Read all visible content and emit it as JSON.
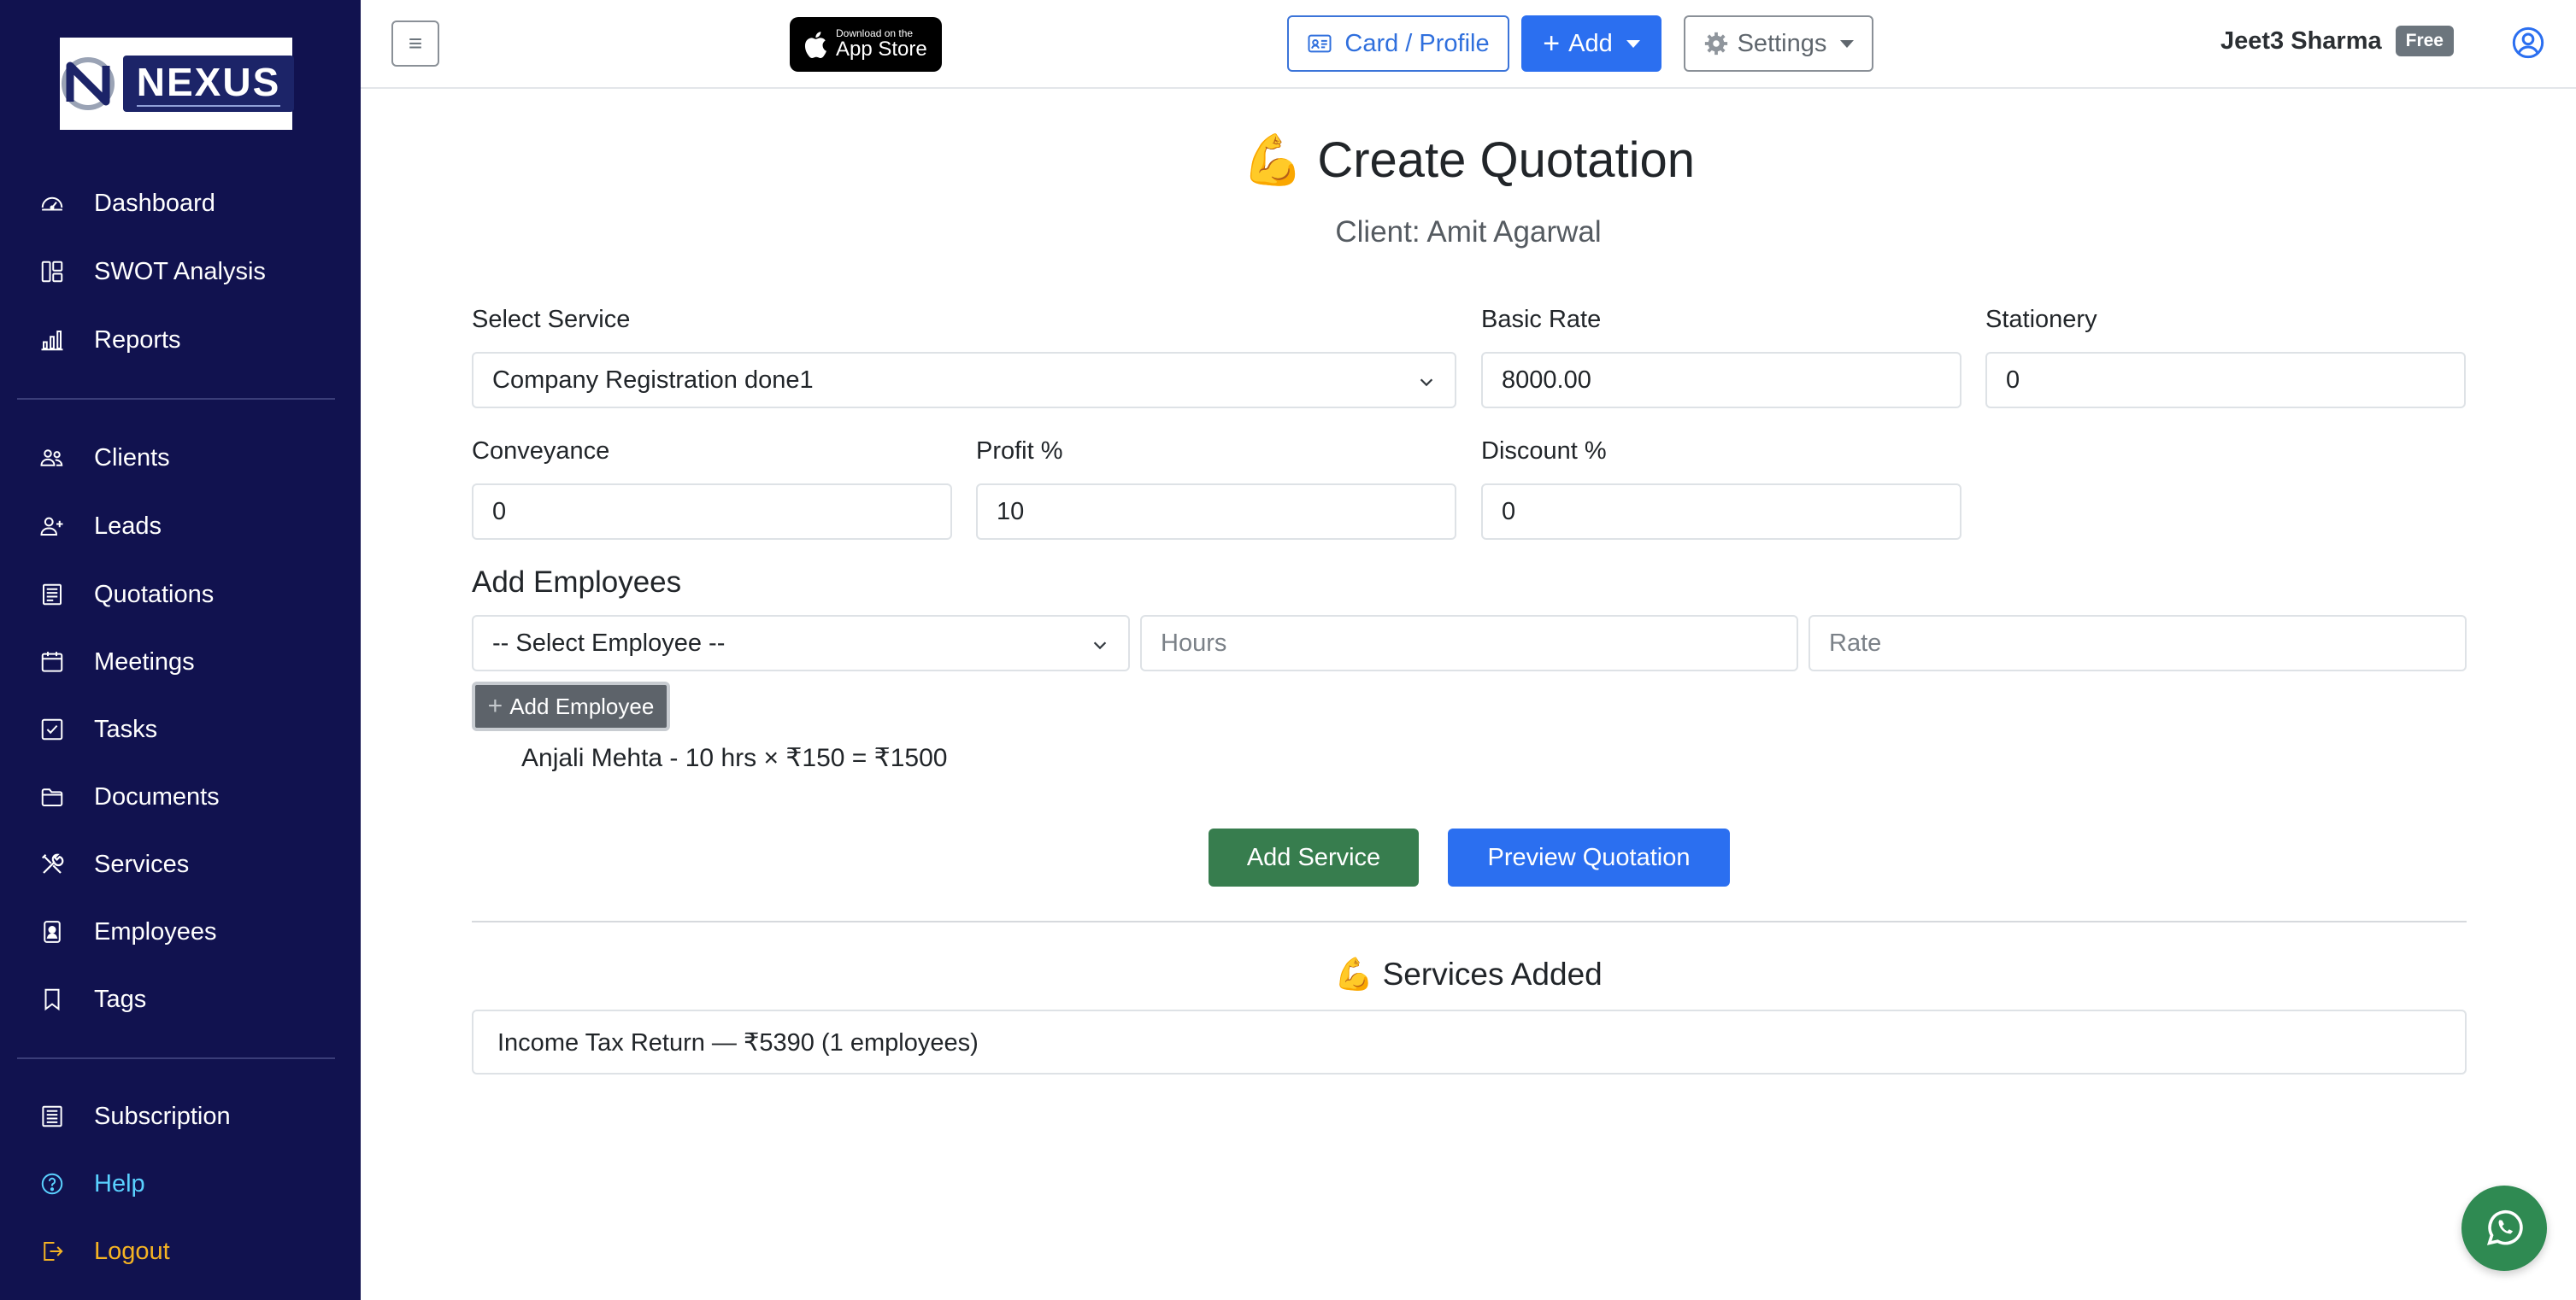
{
  "brand": {
    "logo_text": "NEXUS"
  },
  "sidebar": {
    "items": [
      {
        "label": "Dashboard",
        "icon": "speedometer-icon"
      },
      {
        "label": "SWOT Analysis",
        "icon": "layout-icon"
      },
      {
        "label": "Reports",
        "icon": "bar-chart-icon"
      },
      {
        "label": "Clients",
        "icon": "people-icon"
      },
      {
        "label": "Leads",
        "icon": "person-plus-icon"
      },
      {
        "label": "Quotations",
        "icon": "receipt-icon"
      },
      {
        "label": "Meetings",
        "icon": "calendar-icon"
      },
      {
        "label": "Tasks",
        "icon": "check-square-icon"
      },
      {
        "label": "Documents",
        "icon": "folder-icon"
      },
      {
        "label": "Services",
        "icon": "tools-icon"
      },
      {
        "label": "Employees",
        "icon": "badge-icon"
      },
      {
        "label": "Tags",
        "icon": "bookmark-icon"
      },
      {
        "label": "Subscription",
        "icon": "list-icon"
      },
      {
        "label": "Help",
        "icon": "question-icon"
      },
      {
        "label": "Logout",
        "icon": "logout-icon"
      }
    ]
  },
  "topbar": {
    "toggle_label": "≡",
    "appstore_small": "Download on the",
    "appstore_big": "App Store",
    "card_profile_label": "Card / Profile",
    "add_label": "Add",
    "settings_label": "Settings",
    "user_name": "Jeet3 Sharma",
    "plan_badge": "Free"
  },
  "main": {
    "title_emoji": "💪",
    "title": "Create Quotation",
    "client_line": "Client: Amit Agarwal",
    "form": {
      "service_label": "Select Service",
      "service_value": "Company Registration done1",
      "basic_rate_label": "Basic Rate",
      "basic_rate_value": "8000.00",
      "stationery_label": "Stationery",
      "stationery_value": "0",
      "conveyance_label": "Conveyance",
      "conveyance_value": "0",
      "profit_label": "Profit %",
      "profit_value": "10",
      "discount_label": "Discount %",
      "discount_value": "0"
    },
    "employees": {
      "section_title": "Add Employees",
      "select_placeholder": "-- Select Employee --",
      "hours_placeholder": "Hours",
      "rate_placeholder": "Rate",
      "add_button": "Add Employee",
      "entries": [
        "Anjali Mehta - 10 hrs × ₹150 = ₹1500"
      ]
    },
    "add_service_button": "Add Service",
    "preview_button": "Preview Quotation",
    "services_added_title": "Services Added",
    "services_added": [
      "Income Tax Return — ₹5390 (1 employees)"
    ]
  },
  "colors": {
    "sidebar_bg": "#11124f",
    "primary": "#2b6ff0",
    "success": "#377d4e",
    "help": "#5ad1ff",
    "logout": "#f5b323",
    "whatsapp": "#2f8a52"
  }
}
